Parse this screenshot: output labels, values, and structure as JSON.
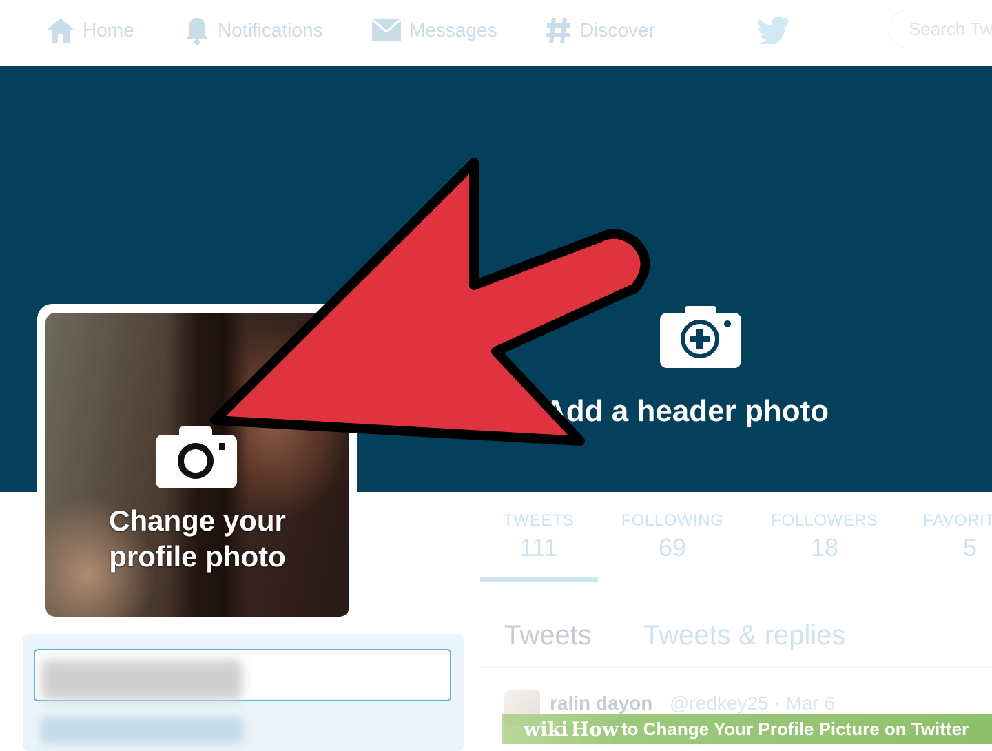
{
  "nav": {
    "items": [
      {
        "label": "Home",
        "icon": "home-icon"
      },
      {
        "label": "Notifications",
        "icon": "bell-icon"
      },
      {
        "label": "Messages",
        "icon": "envelope-icon"
      },
      {
        "label": "Discover",
        "icon": "hashtag-icon"
      }
    ],
    "logo_icon": "twitter-bird-icon",
    "search_placeholder": "Search Tw"
  },
  "header": {
    "add_header_photo": "Add a header photo",
    "camera_icon": "camera-plus-icon"
  },
  "profile": {
    "change_photo_line1": "Change your",
    "change_photo_line2": "profile photo",
    "camera_icon": "camera-icon"
  },
  "stats": [
    {
      "label": "TWEETS",
      "value": "111"
    },
    {
      "label": "FOLLOWING",
      "value": "69"
    },
    {
      "label": "FOLLOWERS",
      "value": "18"
    },
    {
      "label": "FAVORIT",
      "value": "5"
    }
  ],
  "tabs": [
    {
      "label": "Tweets"
    },
    {
      "label": "Tweets & replies"
    }
  ],
  "tweet": {
    "name": "ralin dayon",
    "meta": "@redkey25 · Mar 6"
  },
  "watermark": {
    "logo": "wiki",
    "how": "How",
    "title": "to Change Your Profile Picture on Twitter"
  },
  "colors": {
    "banner": "#04405b",
    "arrow": "#e03340",
    "nav_text": "#c9dde9",
    "watermark_bg": "#8fc06c"
  }
}
